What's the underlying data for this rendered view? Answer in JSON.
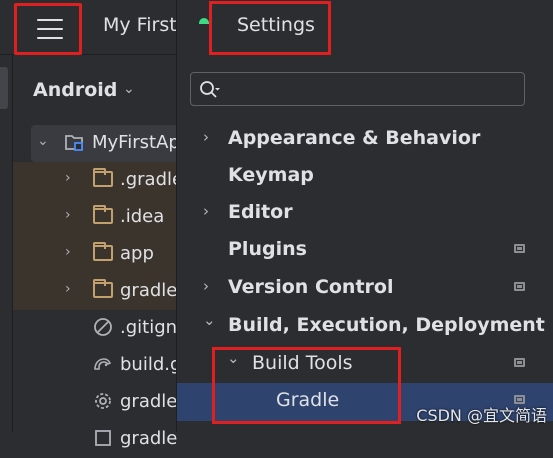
{
  "titlebar": {
    "project_title": "My First"
  },
  "project_panel": {
    "view_label": "Android",
    "tree": [
      {
        "label": "MyFirstAp",
        "icon": "module-icon"
      },
      {
        "label": ".gradle",
        "icon": "folder-icon"
      },
      {
        "label": ".idea",
        "icon": "folder-icon"
      },
      {
        "label": "app",
        "icon": "folder-icon"
      },
      {
        "label": "gradle",
        "icon": "folder-icon"
      },
      {
        "label": ".gitign",
        "icon": "ignore-file-icon"
      },
      {
        "label": "build.g",
        "icon": "gradle-icon"
      },
      {
        "label": "gradle",
        "icon": "gear-icon"
      },
      {
        "label": "gradle",
        "icon": "file-icon"
      }
    ]
  },
  "settings": {
    "title": "Settings",
    "search": {
      "placeholder": "",
      "value": ""
    },
    "items": [
      {
        "label": "Appearance & Behavior",
        "expandable": true,
        "expanded": false
      },
      {
        "label": "Keymap",
        "expandable": false
      },
      {
        "label": "Editor",
        "expandable": true,
        "expanded": false
      },
      {
        "label": "Plugins",
        "expandable": false,
        "project_level": true
      },
      {
        "label": "Version Control",
        "expandable": true,
        "expanded": false,
        "project_level": true
      },
      {
        "label": "Build, Execution, Deployment",
        "expandable": true,
        "expanded": true
      },
      {
        "label": "Build Tools",
        "expandable": true,
        "expanded": true,
        "project_level": true
      },
      {
        "label": "Gradle",
        "selected": true,
        "project_level": true
      }
    ]
  },
  "watermark": "CSDN @宜文简语",
  "colors": {
    "highlight_red": "#e02020",
    "selected_row": "#2e436e",
    "panel_bg": "#2b2d30"
  }
}
